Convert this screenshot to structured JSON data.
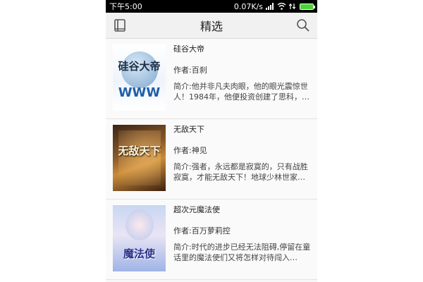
{
  "status_bar": {
    "time": "下午5:00",
    "speed": "0.07K/s",
    "icons": [
      "signal-icon",
      "wifi-icon",
      "transfer-icon",
      "battery-icon"
    ],
    "battery_level": 1.0
  },
  "app_bar": {
    "title": "精选",
    "left_icon": "book-icon",
    "right_icon": "search-icon"
  },
  "books": [
    {
      "title": "硅谷大帝",
      "author": "作者:百刹",
      "intro": "简介:他并非凡夫肉眼，他的眼光震惊世人！1984年，他便投资创建了思科，…",
      "cover_text": "硅谷大帝",
      "cover_sub": "WWW"
    },
    {
      "title": "无敌天下",
      "author": "作者:神见",
      "intro": "简介:强者，永远都是寂寞的，只有战胜寂寞，才能无敌天下！地球少林世家…",
      "cover_text": "无敌天下"
    },
    {
      "title": "超次元魔法使",
      "author": "作者:百万萝莉控",
      "intro": "简介:时代的进步已经无法阻碍,停留在童话里的魔法使们又将怎样对待闯入…",
      "cover_text": "魔法使"
    }
  ],
  "colors": {
    "status_bg": "#000000",
    "appbar_bg": "#f1f1f1",
    "battery": "#4cd137"
  }
}
